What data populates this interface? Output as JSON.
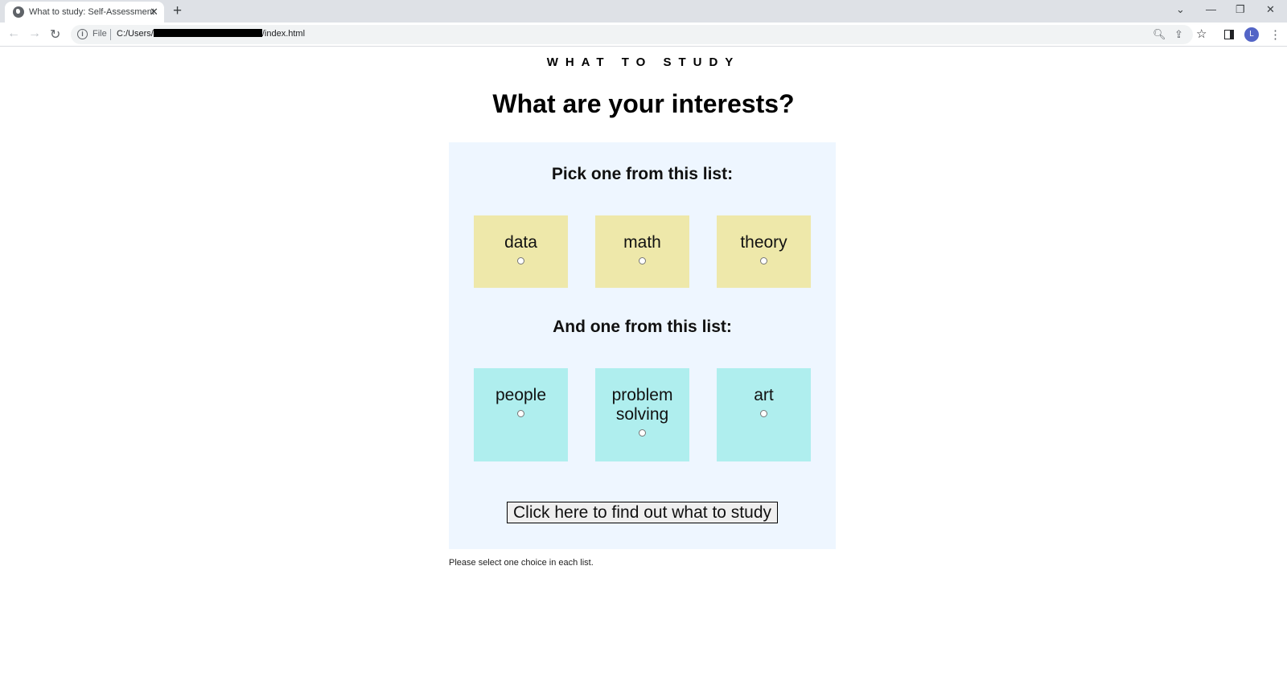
{
  "browser": {
    "tab_title": "What to study: Self-Assessment",
    "tab_close": "✕",
    "new_tab": "+",
    "url_scheme": "File",
    "url_prefix": "C:/Users/",
    "url_suffix": "/index.html",
    "avatar_letter": "L",
    "controls": {
      "tabsearch": "⌄",
      "minimize": "—",
      "restore": "❐",
      "close": "✕"
    },
    "icons": {
      "back": "←",
      "forward": "→",
      "reload": "↻",
      "zoom": "🔍︎",
      "share": "⇪",
      "star": "☆",
      "menu": "⋮"
    }
  },
  "page": {
    "brand": "WHAT TO STUDY",
    "headline": "What are your interests?",
    "list1_title": "Pick one from this list:",
    "list1": [
      {
        "label": "data",
        "selected": false
      },
      {
        "label": "math",
        "selected": false
      },
      {
        "label": "theory",
        "selected": false
      }
    ],
    "list2_title": "And one from this list:",
    "list2": [
      {
        "label": "people",
        "selected": false
      },
      {
        "label": "problem solving",
        "selected": false
      },
      {
        "label": "art",
        "selected": false
      }
    ],
    "submit_label": "Click here to find out what to study",
    "hint": "Please select one choice in each list."
  },
  "colors": {
    "panel": "#eef6ff",
    "list1_card": "#eee8aa",
    "list2_card": "#afeeee"
  }
}
